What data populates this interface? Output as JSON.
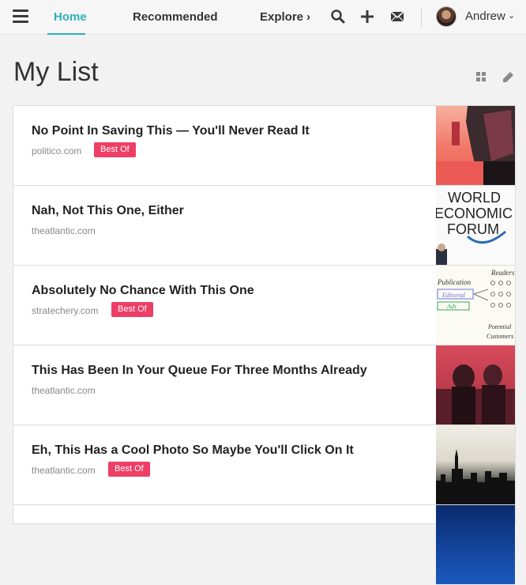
{
  "nav": {
    "home": "Home",
    "recommended": "Recommended",
    "explore": "Explore",
    "explore_chevron": "›",
    "user_name": "Andrew",
    "user_chevron": "⌄"
  },
  "page": {
    "title": "My List"
  },
  "items": [
    {
      "title": "No Point In Saving This — You'll Never Read It",
      "domain": "politico.com",
      "badge": "Best Of"
    },
    {
      "title": "Nah, Not This One, Either",
      "domain": "theatlantic.com",
      "badge": ""
    },
    {
      "title": "Absolutely No Chance With This One",
      "domain": "stratechery.com",
      "badge": "Best Of"
    },
    {
      "title": "This Has Been In Your Queue For Three Months Already",
      "domain": "theatlantic.com",
      "badge": ""
    },
    {
      "title": "Eh, This Has a Cool Photo So Maybe You'll Click On It",
      "domain": "theatlantic.com",
      "badge": "Best Of"
    }
  ],
  "thumb_text": {
    "wef_line1": "WORLD",
    "wef_line2": "ECONOMIC",
    "wef_line3": "FORUM",
    "diag_publication": "Publication",
    "diag_editorial": "Editorial",
    "diag_ads": "Ads",
    "diag_readers": "Readers",
    "diag_potential": "Potential",
    "diag_customers": "Customers"
  },
  "colors": {
    "accent": "#2cb1ba",
    "badge": "#ee3e66"
  }
}
